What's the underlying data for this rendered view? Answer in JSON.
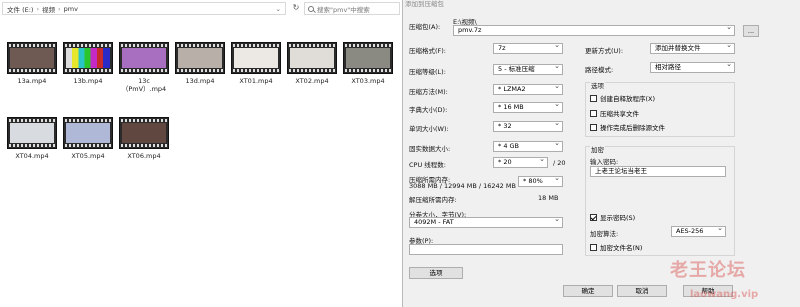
{
  "explorer": {
    "breadcrumb": [
      "文件 (E:)",
      "视频",
      "pmv"
    ],
    "search_placeholder": "搜索\"pmv\"中搜索",
    "files": [
      {
        "name": "13a.mp4",
        "thumb_color": "#6e5a52"
      },
      {
        "name": "13b.mp4",
        "thumb_color": "#c8c828"
      },
      {
        "name": "13c（PmV）.mp4",
        "thumb_color": "#a86ec0"
      },
      {
        "name": "13d.mp4",
        "thumb_color": "#b8b0a8"
      },
      {
        "name": "XT01.mp4",
        "thumb_color": "#ece8e4"
      },
      {
        "name": "XT02.mp4",
        "thumb_color": "#e0dcd8"
      },
      {
        "name": "XT03.mp4",
        "thumb_color": "#8a8a82"
      },
      {
        "name": "XT04.mp4",
        "thumb_color": "#d8dce0"
      },
      {
        "name": "XT05.mp4",
        "thumb_color": "#b0b8d8"
      },
      {
        "name": "XT06.mp4",
        "thumb_color": "#604840"
      }
    ]
  },
  "dialog": {
    "title": "添加到压缩包",
    "archive_label": "压缩包(A):",
    "archive_path": "E:\\视频\\",
    "archive_name": "pmv.7z",
    "browse_label": "...",
    "format_label": "压缩格式(F):",
    "format_value": "7z",
    "level_label": "压缩等级(L):",
    "level_value": "5 - 标准压缩",
    "method_label": "压缩方法(M):",
    "method_value": "* LZMA2",
    "dict_label": "字典大小(D):",
    "dict_value": "* 16 MB",
    "word_label": "单词大小(W):",
    "word_value": "* 32",
    "solid_label": "固实数据大小:",
    "solid_value": "* 4 GB",
    "threads_label": "CPU 线程数:",
    "threads_value": "* 20",
    "threads_total": "/ 20",
    "mem_label": "压缩所需内存:",
    "mem_value": "3088 MB / 12994 MB / 16242 MB",
    "mem_percent": "* 80%",
    "decomp_label": "解压缩所需内存:",
    "decomp_value": "18 MB",
    "split_label": "分卷大小，字节(V):",
    "split_value": "4092M - FAT",
    "params_label": "参数(P):",
    "params_value": "",
    "options_button": "选项",
    "update_label": "更新方式(U):",
    "update_value": "添加并替换文件",
    "path_label": "路径模式:",
    "path_value": "相对路径",
    "options_group": "选项",
    "opt_sfx": "创建自释放程序(X)",
    "opt_shared": "压缩共享文件",
    "opt_delete": "操作完成后删除源文件",
    "encrypt_group": "加密",
    "password_label": "输入密码:",
    "password_value": "上老王论坛当老王",
    "show_password": "显示密码(S)",
    "enc_method_label": "加密算法:",
    "enc_method_value": "AES-256",
    "encrypt_names": "加密文件名(N)",
    "ok_button": "确定",
    "cancel_button": "取消",
    "help_button": "帮助"
  },
  "watermark": {
    "title": "老王论坛",
    "url": "laowang.vip"
  }
}
